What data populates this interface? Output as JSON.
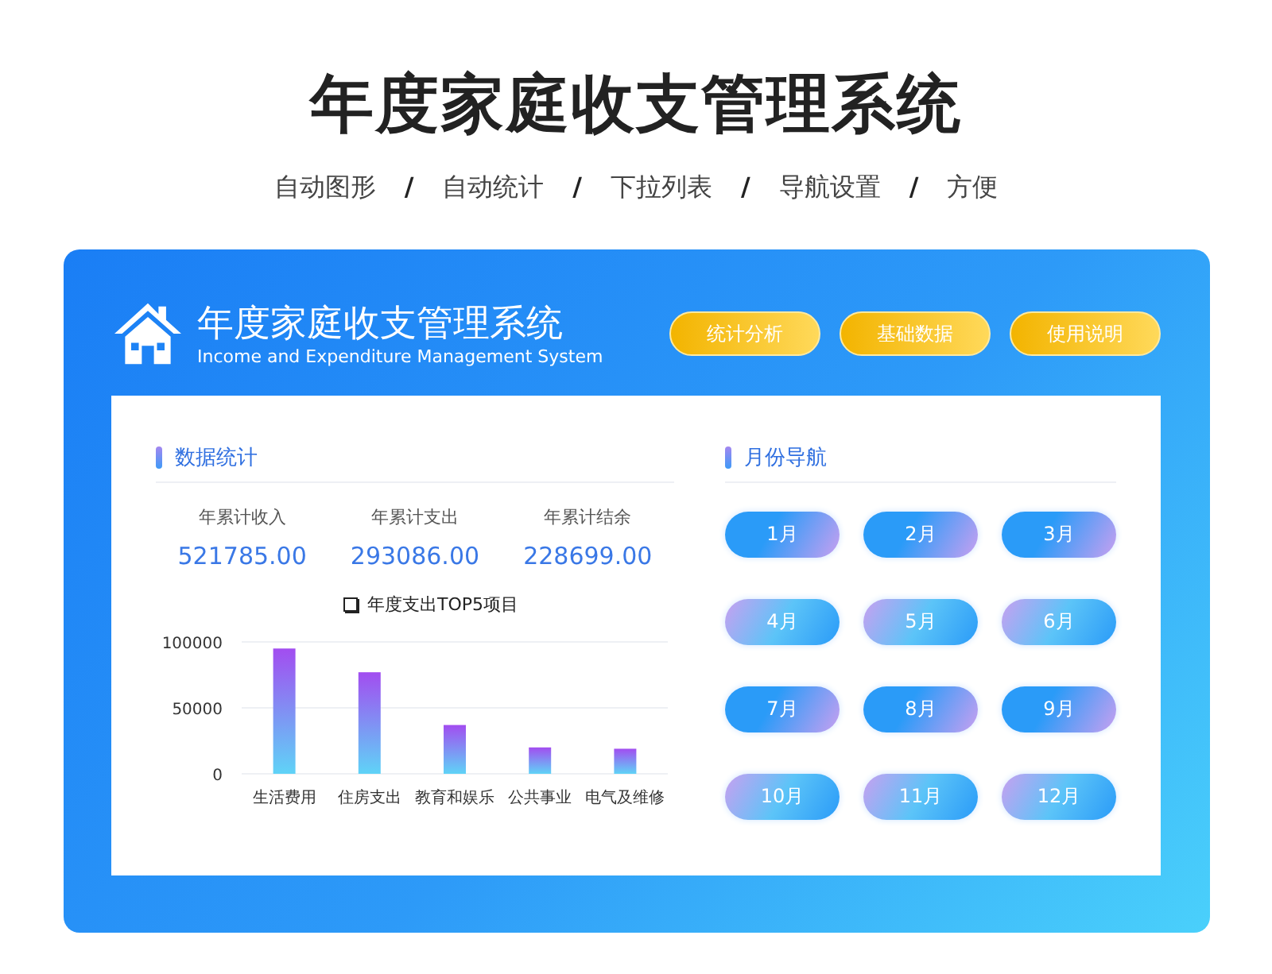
{
  "page_title": "年度家庭收支管理系统",
  "features": [
    {
      "kind": "label",
      "text": "自动图形"
    },
    {
      "kind": "separator",
      "text": "/"
    },
    {
      "kind": "label",
      "text": "自动统计"
    },
    {
      "kind": "separator",
      "text": "/"
    },
    {
      "kind": "label",
      "text": "下拉列表"
    },
    {
      "kind": "separator",
      "text": "/"
    },
    {
      "kind": "label",
      "text": "导航设置"
    },
    {
      "kind": "separator",
      "text": "/"
    },
    {
      "kind": "label",
      "text": "方便"
    }
  ],
  "header": {
    "title": "年度家庭收支管理系统",
    "subtitle": "Income and Expenditure Management System",
    "buttons": [
      "统计分析",
      "基础数据",
      "使用说明"
    ]
  },
  "stats_section": {
    "title": "数据统计",
    "stats": [
      {
        "label": "年累计收入",
        "value": "521785.00"
      },
      {
        "label": "年累计支出",
        "value": "293086.00"
      },
      {
        "label": "年累计结余",
        "value": "228699.00"
      }
    ],
    "chart_data": {
      "type": "bar",
      "title": "年度支出TOP5项目",
      "categories": [
        "生活费用",
        "住房支出",
        "教育和娱乐",
        "公共事业",
        "电气及维修"
      ],
      "values": [
        95000,
        77000,
        37000,
        20000,
        19000
      ],
      "ylim": [
        0,
        100000
      ],
      "yticks": [
        0,
        50000,
        100000
      ]
    }
  },
  "month_nav": {
    "title": "月份导航",
    "months": [
      "1月",
      "2月",
      "3月",
      "4月",
      "5月",
      "6月",
      "7月",
      "8月",
      "9月",
      "10月",
      "11月",
      "12月"
    ]
  }
}
